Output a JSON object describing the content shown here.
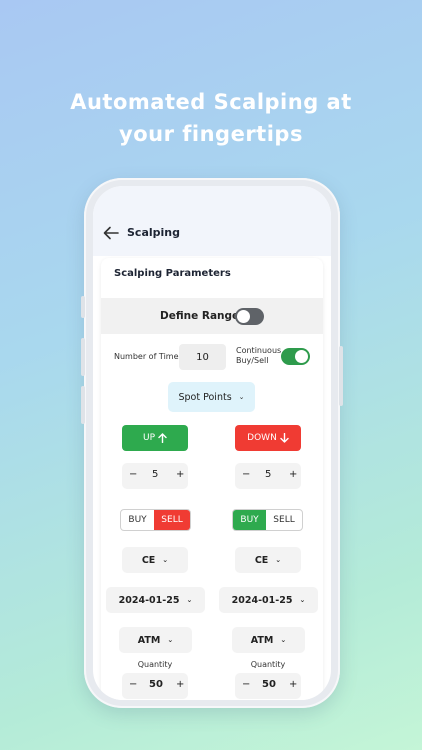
{
  "headline": {
    "line1": "Automated Scalping at",
    "line2": "your fingertips"
  },
  "appbar": {
    "title": "Scalping",
    "back_icon": "arrow-left-icon"
  },
  "card": {
    "title": "Scalping Parameters",
    "define_range": {
      "label": "Define Range",
      "on": false
    },
    "number_of_times": {
      "label": "Number of Times",
      "value": "10"
    },
    "continuous": {
      "label_line1": "Continuous",
      "label_line2": "Buy/Sell",
      "on": true
    },
    "spot": {
      "value": "Spot Points"
    },
    "up": {
      "button": "UP",
      "quantity_step": "5",
      "buy_label": "BUY",
      "sell_label": "SELL",
      "selected": "SELL",
      "option_type": "CE",
      "expiry": "2024-01-25",
      "strike": "ATM",
      "quantity_label": "Quantity",
      "quantity": "50"
    },
    "down": {
      "button": "DOWN",
      "quantity_step": "5",
      "buy_label": "BUY",
      "sell_label": "SELL",
      "selected": "BUY",
      "option_type": "CE",
      "expiry": "2024-01-25",
      "strike": "ATM",
      "quantity_label": "Quantity",
      "quantity": "50"
    },
    "stepper_minus": "−",
    "stepper_plus": "+"
  },
  "colors": {
    "green": "#2eaa4e",
    "red": "#f03b33",
    "toggle_off": "#5f6368",
    "toggle_on": "#2e9b4c"
  }
}
